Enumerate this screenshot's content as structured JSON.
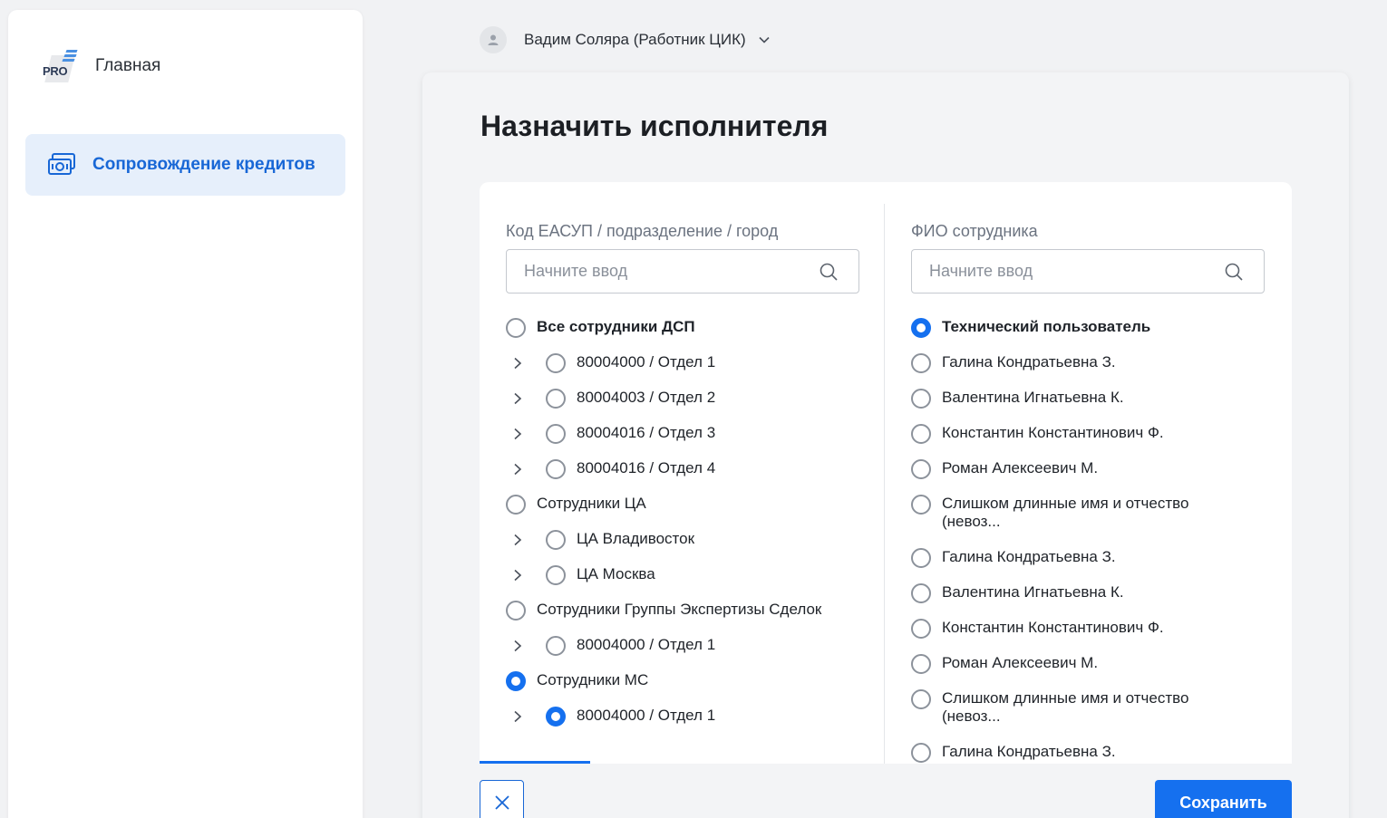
{
  "sidebar": {
    "logo_text": "PRO",
    "home_label": "Главная",
    "nav_item_label": "Сопровождение кредитов"
  },
  "user": {
    "name": "Вадим Соляра (Работник ЦИК)"
  },
  "dialog": {
    "title": "Назначить исполнителя",
    "left": {
      "label": "Код ЕАСУП / подразделение / город",
      "search_placeholder": "Начните ввод",
      "items": [
        {
          "label": "Все сотрудники ДСП",
          "level": 0,
          "bold": true,
          "checked": false
        },
        {
          "label": "80004000 / Отдел 1",
          "level": 1,
          "checked": false
        },
        {
          "label": "80004003 / Отдел 2",
          "level": 1,
          "checked": false
        },
        {
          "label": "80004016 / Отдел 3",
          "level": 1,
          "checked": false
        },
        {
          "label": "80004016 / Отдел 4",
          "level": 1,
          "checked": false
        },
        {
          "label": "Сотрудники ЦА",
          "level": 0,
          "checked": false
        },
        {
          "label": "ЦА Владивосток",
          "level": 1,
          "checked": false
        },
        {
          "label": "ЦА Москва",
          "level": 1,
          "checked": false
        },
        {
          "label": "Сотрудники Группы Экспертизы Сделок",
          "level": 0,
          "checked": false
        },
        {
          "label": "80004000 / Отдел 1",
          "level": 1,
          "checked": false
        },
        {
          "label": "Сотрудники МС",
          "level": 0,
          "checked": true
        },
        {
          "label": "80004000 / Отдел 1",
          "level": 1,
          "checked": true
        }
      ]
    },
    "right": {
      "label": "ФИО сотрудника",
      "search_placeholder": "Начните ввод",
      "items": [
        {
          "label": "Технический пользователь",
          "bold": true,
          "checked": true
        },
        {
          "label": "Галина Кондратьевна З.",
          "checked": false
        },
        {
          "label": "Валентина Игнатьевна К.",
          "checked": false
        },
        {
          "label": "Константин Константинович Ф.",
          "checked": false
        },
        {
          "label": "Роман Алексеевич М.",
          "checked": false
        },
        {
          "label": "Слишком длинные имя и отчество\n(невоз...",
          "checked": false
        },
        {
          "label": "Галина Кондратьевна З.",
          "checked": false
        },
        {
          "label": "Валентина Игнатьевна К.",
          "checked": false
        },
        {
          "label": "Константин Константинович Ф.",
          "checked": false
        },
        {
          "label": "Роман Алексеевич М.",
          "checked": false
        },
        {
          "label": "Слишком длинные имя и отчество\n(невоз...",
          "checked": false
        },
        {
          "label": "Галина Кондратьевна З.",
          "checked": false
        }
      ]
    },
    "save_label": "Сохранить"
  },
  "colors": {
    "accent": "#1570ef",
    "nav_bg": "#e6effb",
    "page_bg": "#f1f2f4"
  },
  "icons": {
    "nav": "money-icon",
    "search": "search-icon",
    "cancel": "close-icon",
    "expand": "chevron-right-icon",
    "user": "user-icon",
    "user_menu": "chevron-down-icon"
  }
}
